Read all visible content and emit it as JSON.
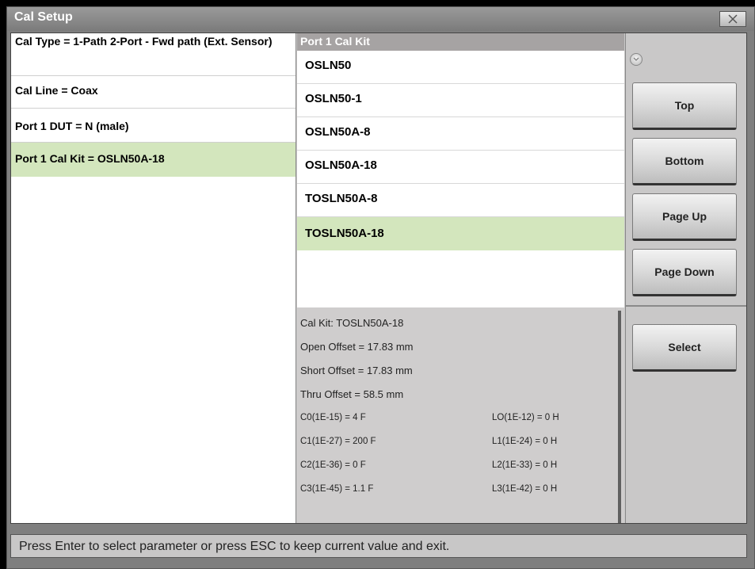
{
  "window": {
    "title": "Cal Setup"
  },
  "params": [
    {
      "label": "Cal Type = 1-Path 2-Port - Fwd path (Ext. Sensor)"
    },
    {
      "label": "Cal Line = Coax"
    },
    {
      "label": "Port 1 DUT = N (male)"
    },
    {
      "label": "Port 1 Cal Kit = OSLN50A-18"
    }
  ],
  "kit_list": {
    "header": "Port 1 Cal Kit",
    "items": [
      "OSLN50",
      "OSLN50-1",
      "OSLN50A-8",
      "OSLN50A-18",
      "TOSLN50A-8",
      "TOSLN50A-18"
    ],
    "selected": "TOSLN50A-18"
  },
  "info": {
    "kit": "Cal Kit: TOSLN50A-18",
    "open": "Open Offset = 17.83 mm",
    "short": "Short Offset = 17.83 mm",
    "thru": "Thru Offset = 58.5 mm",
    "c0": "C0(1E-15) = 4 F",
    "c1": "C1(1E-27) = 200 F",
    "c2": "C2(1E-36) = 0 F",
    "c3": "C3(1E-45) = 1.1 F",
    "l0": "LO(1E-12) = 0 H",
    "l1": "L1(1E-24) = 0 H",
    "l2": "L2(1E-33) = 0 H",
    "l3": "L3(1E-42) = 0 H"
  },
  "buttons": {
    "top": "Top",
    "bottom": "Bottom",
    "page_up": "Page Up",
    "page_down": "Page Down",
    "select": "Select"
  },
  "status": "Press Enter to select parameter or press ESC to keep current value and exit.",
  "colors": {
    "selection": "#d3e6bd",
    "title_bar": "#8a8a8a"
  }
}
